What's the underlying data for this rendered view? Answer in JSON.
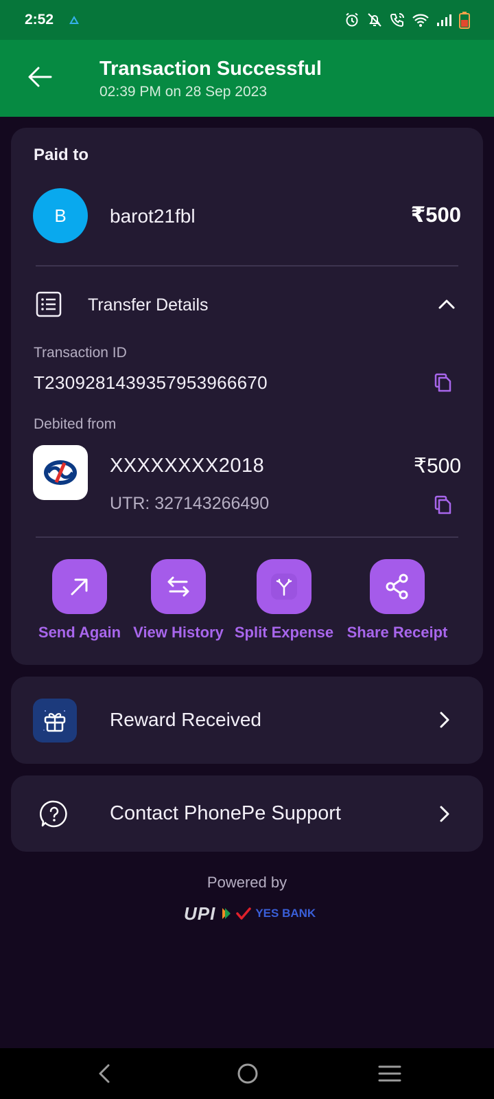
{
  "status_bar": {
    "time": "2:52"
  },
  "header": {
    "title": "Transaction Successful",
    "subtitle": "02:39 PM on 28 Sep 2023"
  },
  "paid_to": {
    "label": "Paid to",
    "avatar_initial": "B",
    "name": "barot21fbl",
    "amount": "₹500"
  },
  "transfer_details": {
    "label": "Transfer Details",
    "transaction_id_label": "Transaction ID",
    "transaction_id": "T2309281439357953966670",
    "debited_from_label": "Debited from",
    "account": "XXXXXXXX2018",
    "amount": "₹500",
    "utr": "UTR: 327143266490"
  },
  "actions": [
    {
      "label": "Send Again",
      "icon": "arrow-up-right-icon"
    },
    {
      "label": "View History",
      "icon": "swap-arrows-icon"
    },
    {
      "label": "Split Expense",
      "icon": "split-icon"
    },
    {
      "label": "Share Receipt",
      "icon": "share-icon"
    }
  ],
  "reward": {
    "label": "Reward Received",
    "icon": "gift-icon"
  },
  "support": {
    "label": "Contact PhonePe Support",
    "icon": "help-circle-icon"
  },
  "footer": {
    "powered_by": "Powered by",
    "upi_logo_text": "UPI",
    "partner_bank": "YES BANK"
  },
  "colors": {
    "status_bar": "#06763a",
    "header": "#068a42",
    "background": "#14091f",
    "card": "#231a32",
    "accent": "#a55bea",
    "avatar": "#09a9ee"
  }
}
